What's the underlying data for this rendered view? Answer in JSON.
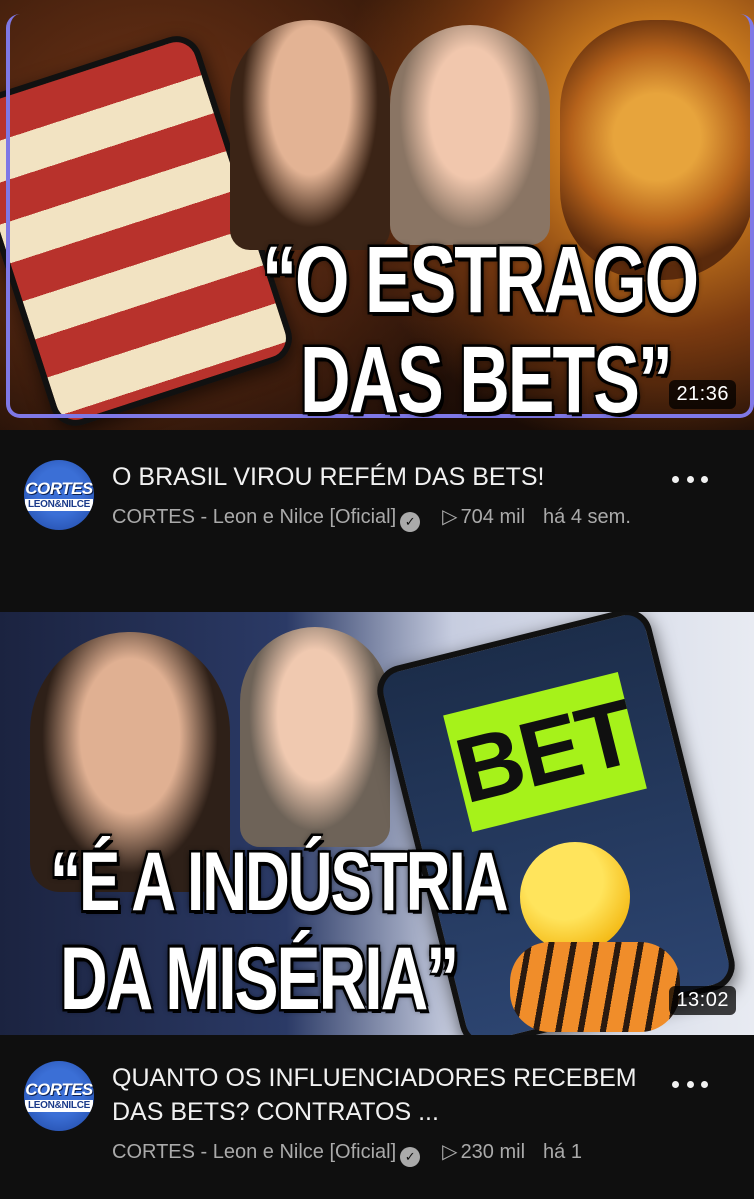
{
  "videos": [
    {
      "thumbnail": {
        "headline_line1": "“O ESTRAGO",
        "headline_line2": "DAS BETS”",
        "duration": "21:36"
      },
      "title": "O BRASIL VIROU REFÉM DAS BETS!",
      "channel": {
        "name": "CORTES - Leon e Nilce [Oficial]",
        "avatar_top": "CORTES",
        "avatar_bottom": "LEON&NILCE",
        "verified_icon": "✓"
      },
      "views": "704 mil",
      "age": "há 4 sem."
    },
    {
      "thumbnail": {
        "headline_line1": "“É A INDÚSTRIA",
        "headline_line2": "DA MISÉRIA”",
        "sticker": "BET",
        "duration": "13:02"
      },
      "title": "QUANTO OS INFLUENCIADORES RECEBEM DAS BETS? CONTRATOS ...",
      "channel": {
        "name": "CORTES - Leon e Nilce [Oficial]",
        "avatar_top": "CORTES",
        "avatar_bottom": "LEON&NILCE",
        "verified_icon": "✓"
      },
      "views": "230 mil",
      "age": "há 1"
    }
  ],
  "icons": {
    "play": "▷",
    "more": "more-vert-icon"
  },
  "colors": {
    "background": "#0f0f0f",
    "text_primary": "#f1f1f1",
    "text_secondary": "#aaaaaa",
    "avatar_blue": "#2f5fc9",
    "bet_green": "#a6f21a"
  }
}
